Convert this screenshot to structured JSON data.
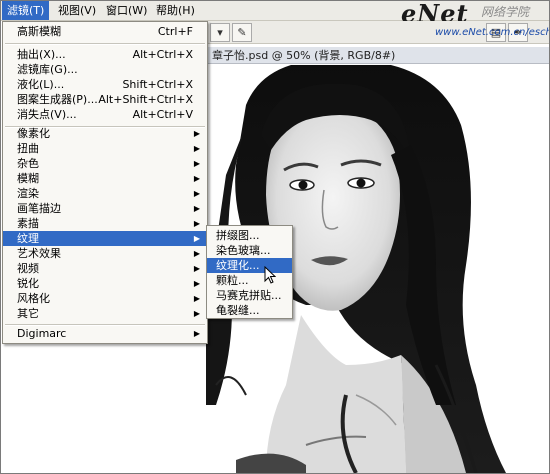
{
  "menubar": {
    "items": [
      {
        "label": "滤镜(T)"
      },
      {
        "label": "视图(V)"
      },
      {
        "label": "窗口(W)"
      },
      {
        "label": "帮助(H)"
      }
    ]
  },
  "document": {
    "title": "章子怡.psd @ 50% (背景, RGB/8#)"
  },
  "watermark": {
    "logo": "eNet",
    "cn": "网络学院",
    "url": "www.eNet.com.cn/eschool"
  },
  "filter_menu": {
    "last_filter": {
      "label": "高斯模糊",
      "shortcut": "Ctrl+F"
    },
    "group1": [
      {
        "label": "抽出(X)...",
        "shortcut": "Alt+Ctrl+X"
      },
      {
        "label": "滤镜库(G)...",
        "shortcut": ""
      },
      {
        "label": "液化(L)...",
        "shortcut": "Shift+Ctrl+X"
      },
      {
        "label": "图案生成器(P)...",
        "shortcut": "Alt+Shift+Ctrl+X"
      },
      {
        "label": "消失点(V)...",
        "shortcut": "Alt+Ctrl+V"
      }
    ],
    "group2": [
      {
        "label": "像素化"
      },
      {
        "label": "扭曲"
      },
      {
        "label": "杂色"
      },
      {
        "label": "模糊"
      },
      {
        "label": "渲染"
      },
      {
        "label": "画笔描边"
      },
      {
        "label": "素描"
      },
      {
        "label": "纹理"
      },
      {
        "label": "艺术效果"
      },
      {
        "label": "视频"
      },
      {
        "label": "锐化"
      },
      {
        "label": "风格化"
      },
      {
        "label": "其它"
      }
    ],
    "group3": [
      {
        "label": "Digimarc"
      }
    ]
  },
  "texture_submenu": {
    "items": [
      {
        "label": "拼缀图..."
      },
      {
        "label": "染色玻璃..."
      },
      {
        "label": "纹理化..."
      },
      {
        "label": "颗粒..."
      },
      {
        "label": "马赛克拼贴..."
      },
      {
        "label": "龟裂缝..."
      }
    ]
  },
  "colors": {
    "highlight": "#316ac5",
    "menu_bg": "#f9f8f4",
    "bar_bg": "#ecebe6"
  }
}
